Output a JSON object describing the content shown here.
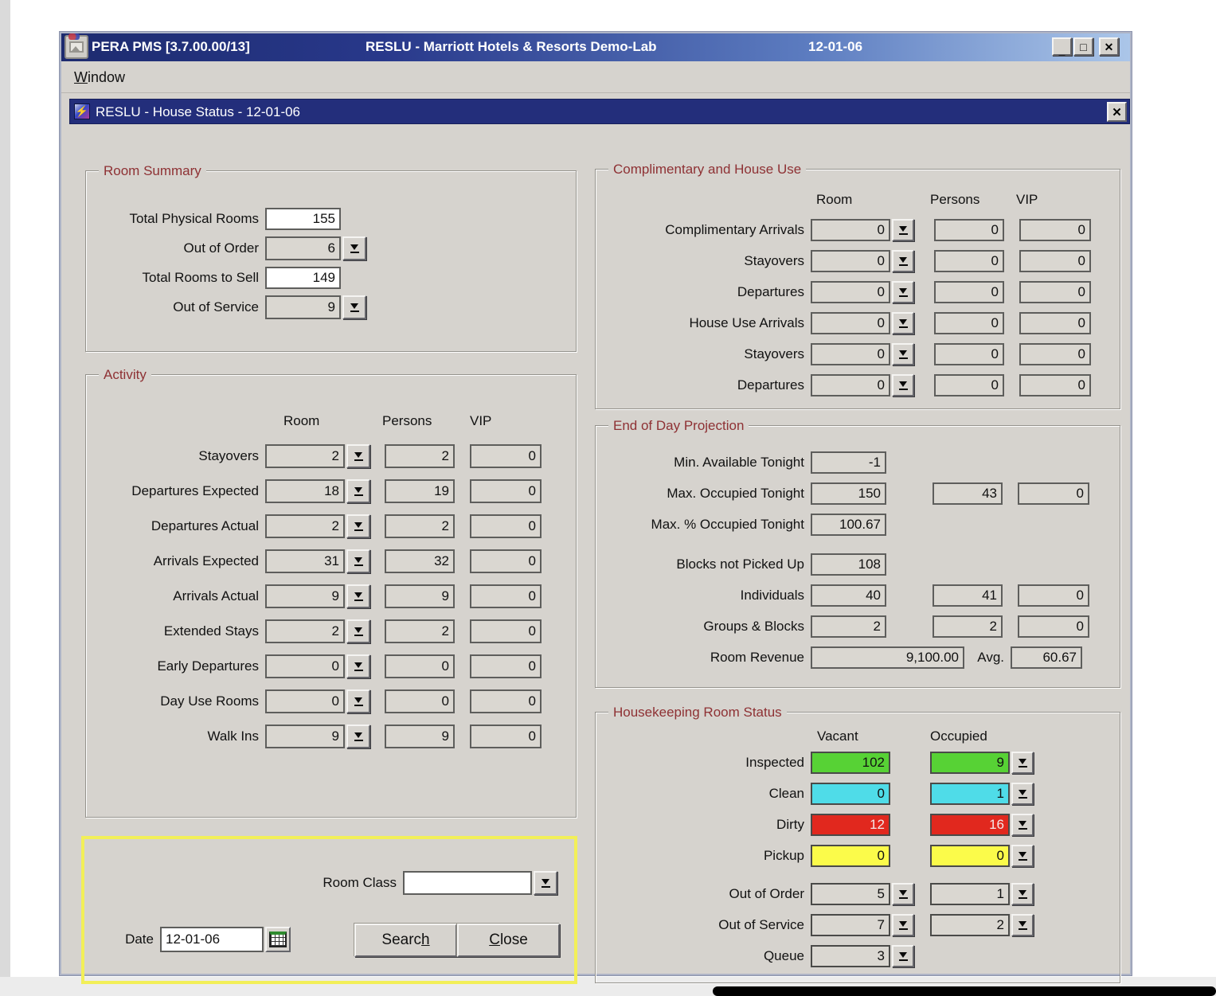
{
  "titlebar": {
    "app_title": "PERA PMS [3.7.00.00/13]",
    "session_title": "RESLU - Marriott Hotels & Resorts Demo-Lab",
    "date": "12-01-06",
    "minimize_glyph": "_",
    "maximize_glyph": "□",
    "close_glyph": "✕"
  },
  "menubar": {
    "window_item": {
      "key": "W",
      "post": "indow"
    }
  },
  "child_window": {
    "title": "RESLU - House Status - 12-01-06",
    "close_glyph": "✕",
    "icon": "lightning-bolt"
  },
  "room_summary": {
    "title": "Room Summary",
    "rows": [
      {
        "label": "Total Physical Rooms",
        "value": "155"
      },
      {
        "label": "Out of Order",
        "value": "6"
      },
      {
        "label": "Total Rooms to Sell",
        "value": "149"
      },
      {
        "label": "Out of Service",
        "value": "9"
      }
    ]
  },
  "activity": {
    "title": "Activity",
    "headers": {
      "room": "Room",
      "persons": "Persons",
      "vip": "VIP"
    },
    "rows": [
      {
        "label": "Stayovers",
        "room": "2",
        "persons": "2",
        "vip": "0"
      },
      {
        "label": "Departures Expected",
        "room": "18",
        "persons": "19",
        "vip": "0"
      },
      {
        "label": "Departures Actual",
        "room": "2",
        "persons": "2",
        "vip": "0"
      },
      {
        "label": "Arrivals Expected",
        "room": "31",
        "persons": "32",
        "vip": "0"
      },
      {
        "label": "Arrivals Actual",
        "room": "9",
        "persons": "9",
        "vip": "0"
      },
      {
        "label": "Extended Stays",
        "room": "2",
        "persons": "2",
        "vip": "0"
      },
      {
        "label": "Early Departures",
        "room": "0",
        "persons": "0",
        "vip": "0"
      },
      {
        "label": "Day Use Rooms",
        "room": "0",
        "persons": "0",
        "vip": "0"
      },
      {
        "label": "Walk Ins",
        "room": "9",
        "persons": "9",
        "vip": "0"
      }
    ]
  },
  "comp_house": {
    "title": "Complimentary and House Use",
    "headers": {
      "room": "Room",
      "persons": "Persons",
      "vip": "VIP"
    },
    "rows": [
      {
        "label": "Complimentary Arrivals",
        "room": "0",
        "persons": "0",
        "vip": "0"
      },
      {
        "label": "Stayovers",
        "room": "0",
        "persons": "0",
        "vip": "0"
      },
      {
        "label": "Departures",
        "room": "0",
        "persons": "0",
        "vip": "0"
      },
      {
        "label": "House Use Arrivals",
        "room": "0",
        "persons": "0",
        "vip": "0"
      },
      {
        "label": "Stayovers",
        "room": "0",
        "persons": "0",
        "vip": "0"
      },
      {
        "label": "Departures",
        "room": "0",
        "persons": "0",
        "vip": "0"
      }
    ]
  },
  "eod": {
    "title": "End of Day Projection",
    "min_available_label": "Min. Available Tonight",
    "min_available": "-1",
    "max_occupied_label": "Max. Occupied Tonight",
    "max_occupied_room": "150",
    "max_occupied_persons": "43",
    "max_occupied_vip": "0",
    "max_pct_label": "Max. % Occupied Tonight",
    "max_pct": "100.67",
    "blocks_label": "Blocks not Picked Up",
    "blocks": "108",
    "individuals_label": "Individuals",
    "individuals_room": "40",
    "individuals_persons": "41",
    "individuals_vip": "0",
    "groups_label": "Groups & Blocks",
    "groups_room": "2",
    "groups_persons": "2",
    "groups_vip": "0",
    "revenue_label": "Room Revenue",
    "revenue": "9,100.00",
    "avg_label": "Avg.",
    "avg": "60.67"
  },
  "housekeeping": {
    "title": "Housekeeping Room Status",
    "headers": {
      "vacant": "Vacant",
      "occupied": "Occupied"
    },
    "rows": [
      {
        "label": "Inspected",
        "vacant": "102",
        "occupied": "9",
        "color": "#57d235"
      },
      {
        "label": "Clean",
        "vacant": "0",
        "occupied": "1",
        "color": "#4fdce8"
      },
      {
        "label": "Dirty",
        "vacant": "12",
        "occupied": "16",
        "color": "#e1281e"
      },
      {
        "label": "Pickup",
        "vacant": "0",
        "occupied": "0",
        "color": "#fbfb4a"
      }
    ],
    "ooo_label": "Out of Order",
    "ooo_vacant": "5",
    "ooo_occupied": "1",
    "oos_label": "Out of Service",
    "oos_vacant": "7",
    "oos_occupied": "2",
    "queue_label": "Queue",
    "queue": "3"
  },
  "search_panel": {
    "room_class_label": "Room Class",
    "room_class_value": "",
    "date_label": "Date",
    "date_value": "12-01-06",
    "search_button": {
      "pre": "Searc",
      "key": "h",
      "post": ""
    },
    "close_button": {
      "pre": "",
      "key": "C",
      "post": "lose"
    }
  },
  "icons": {
    "app": "broken-image-photo",
    "child": "lightning-bolt",
    "lov": "down-arrow-with-bar",
    "calendar": "calendar-grid"
  }
}
